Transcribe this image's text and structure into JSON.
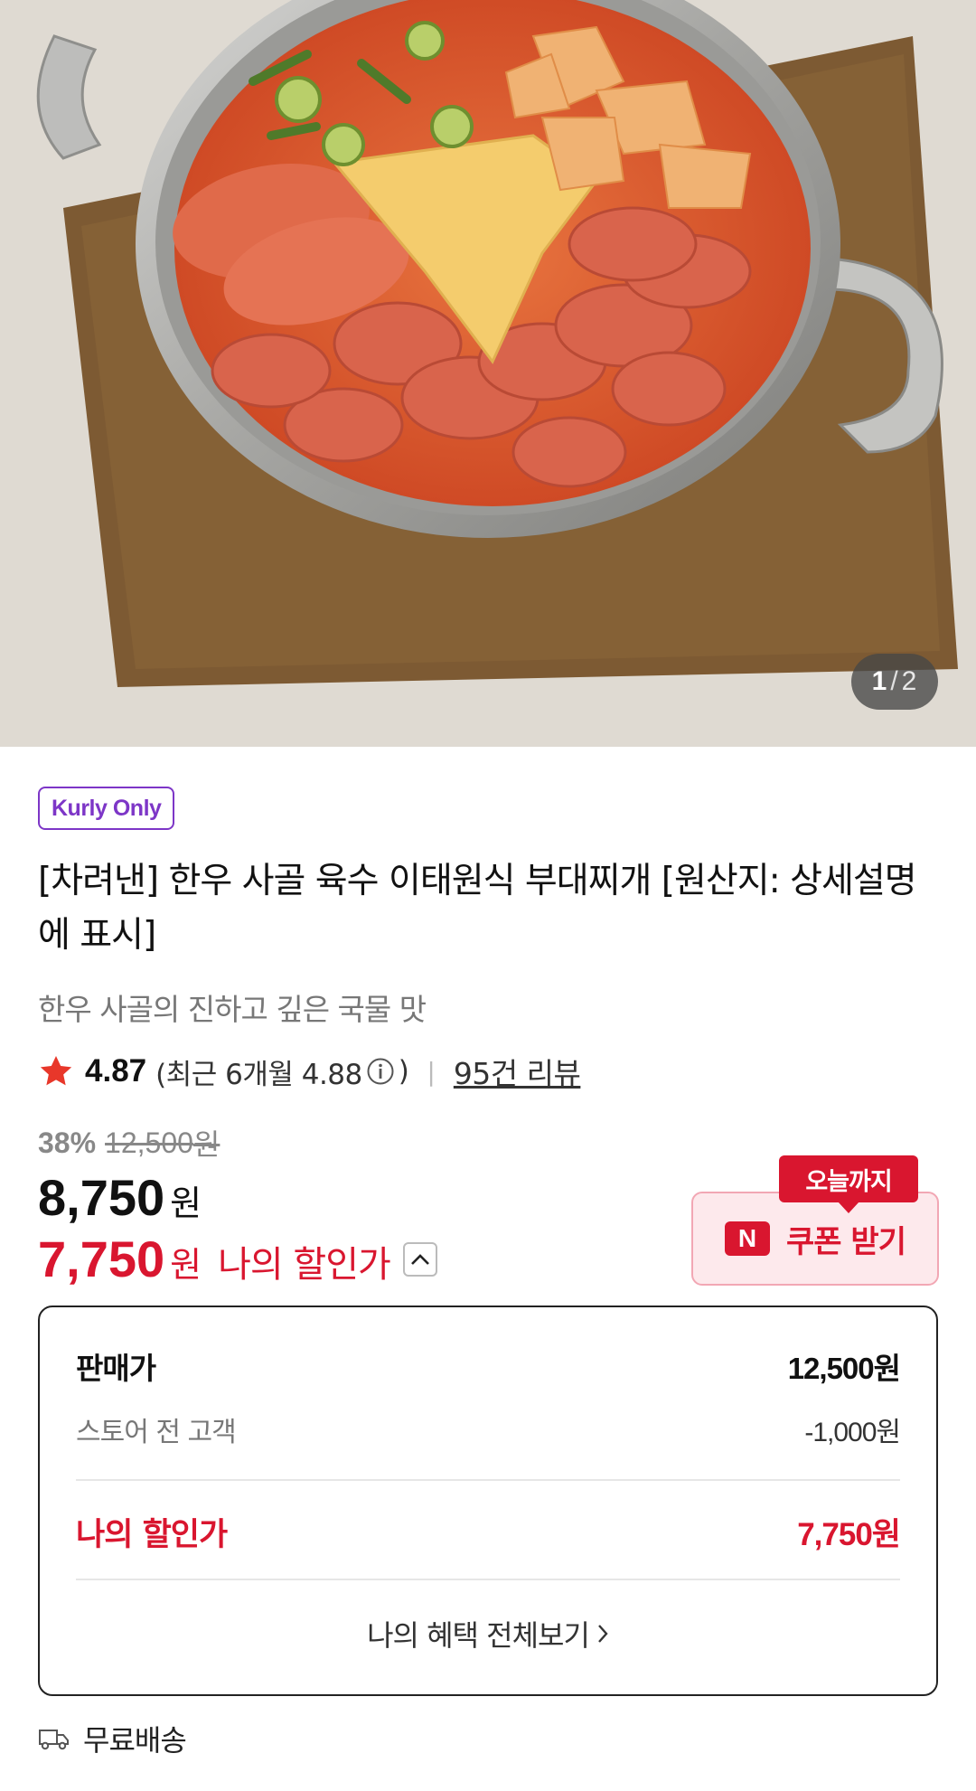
{
  "gallery": {
    "current": "1",
    "separator": "/",
    "total": "2"
  },
  "product": {
    "badge": "Kurly Only",
    "title": "[차려낸] 한우 사골 육수 이태원식 부대찌개 [원산지: 상세설명에 표시]",
    "subtitle": "한우 사골의 진하고 깊은 국물 맛"
  },
  "rating": {
    "score": "4.87",
    "recent_prefix": "(최근 6개월 4.88",
    "recent_suffix": ")",
    "divider": "|",
    "reviews": "95건 리뷰"
  },
  "price": {
    "discount_rate": "38%",
    "original": "12,500",
    "original_unit": "원",
    "sale": "8,750",
    "sale_unit": "원",
    "my_price": "7,750",
    "my_price_unit": "원",
    "my_price_label": "나의 할인가"
  },
  "coupon": {
    "badge": "오늘까지",
    "logo": "N",
    "label": "쿠폰 받기"
  },
  "detail": {
    "sell_label": "판매가",
    "sell_value": "12,500원",
    "store_label": "스토어 전 고객",
    "store_value": "-1,000원",
    "my_label": "나의 할인가",
    "my_value": "7,750원",
    "link": "나의 혜택 전체보기"
  },
  "shipping": {
    "label": "무료배송"
  },
  "colors": {
    "accent_red": "#d9162f",
    "kurly_purple": "#7d36c7",
    "coupon_bg": "#fde9ec"
  }
}
